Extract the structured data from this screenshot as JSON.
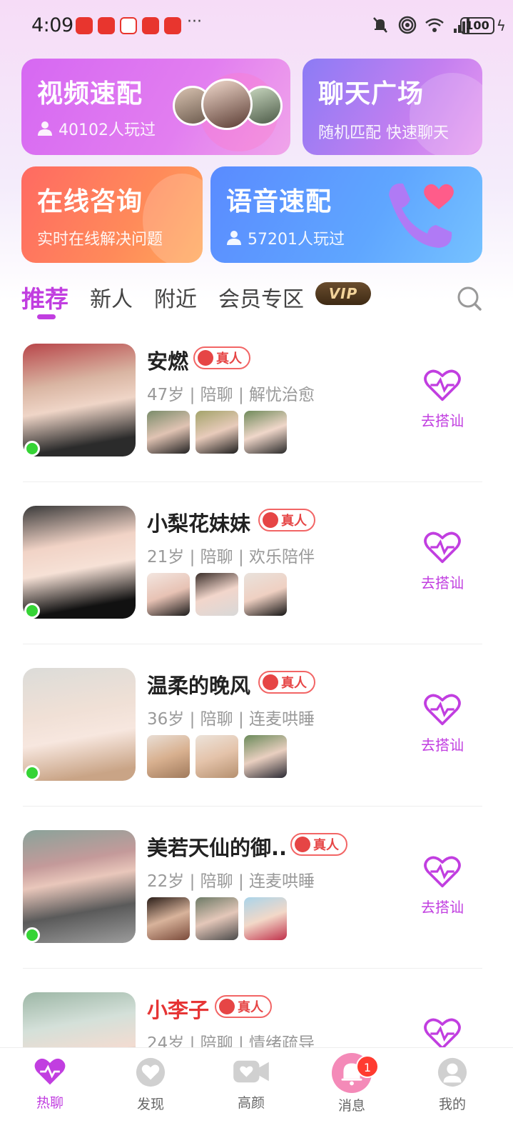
{
  "status_bar": {
    "time": "4:09",
    "battery": "100",
    "more": "···"
  },
  "cards": {
    "video": {
      "title": "视频速配",
      "sub": "40102人玩过"
    },
    "chat": {
      "title": "聊天广场",
      "sub": "随机匹配 快速聊天"
    },
    "consult": {
      "title": "在线咨询",
      "sub": "实时在线解决问题"
    },
    "voice": {
      "title": "语音速配",
      "sub": "57201人玩过"
    }
  },
  "tabs": [
    {
      "label": "推荐",
      "active": true
    },
    {
      "label": "新人",
      "active": false
    },
    {
      "label": "附近",
      "active": false
    },
    {
      "label": "会员专区",
      "active": false
    }
  ],
  "vip_label": "VIP",
  "real_label": "真人",
  "greet_label": "去搭讪",
  "users": [
    {
      "name": "安燃",
      "meta": "47岁 | 陪聊 | 解忧治愈",
      "online": true
    },
    {
      "name": "小梨花妹妹",
      "meta": "21岁 | 陪聊 | 欢乐陪伴",
      "online": true
    },
    {
      "name": "温柔的晚风",
      "meta": "36岁 | 陪聊 | 连麦哄睡",
      "online": true
    },
    {
      "name": "美若天仙的御..",
      "meta": "22岁 | 陪聊 | 连麦哄睡",
      "online": true
    },
    {
      "name": "小李子",
      "meta": "24岁 | 陪聊 | 情绪疏导",
      "online": false
    }
  ],
  "bottom_nav": [
    {
      "label": "热聊",
      "icon": "heart-pulse-icon",
      "active": true
    },
    {
      "label": "发现",
      "icon": "heart-circle-icon",
      "active": false
    },
    {
      "label": "高颜",
      "icon": "video-camera-icon",
      "active": false
    },
    {
      "label": "消息",
      "icon": "bell-icon",
      "active": false,
      "badge": "1"
    },
    {
      "label": "我的",
      "icon": "profile-icon",
      "active": false
    }
  ],
  "colors": {
    "accent": "#c13ee0",
    "online": "#35d435",
    "real_badge": "#e64545"
  }
}
